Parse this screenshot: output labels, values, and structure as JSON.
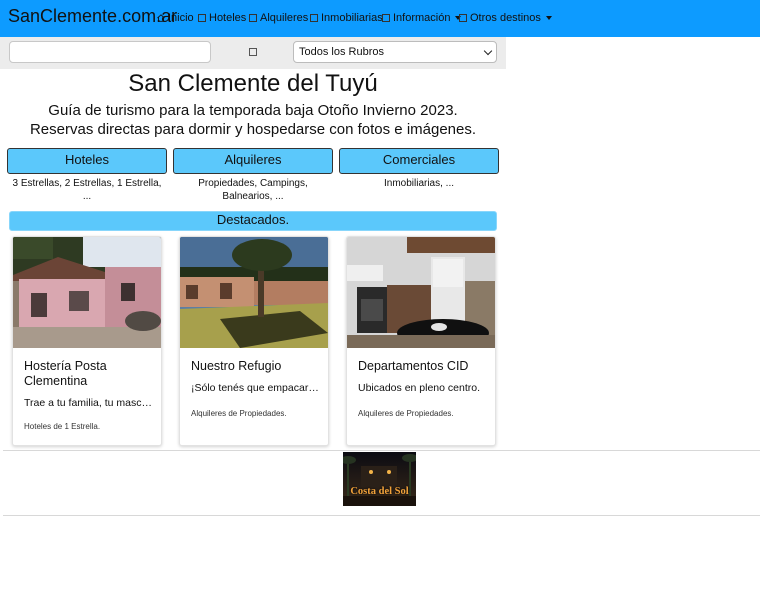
{
  "navbar": {
    "brand": "SanClemente.com.ar",
    "items": [
      {
        "label": "Inicio",
        "icon": "home-icon"
      },
      {
        "label": "Hoteles",
        "icon": "square-icon"
      },
      {
        "label": "Alquileres",
        "icon": "square-icon"
      },
      {
        "label": "Inmobiliarias",
        "icon": "square-icon"
      },
      {
        "label": "Información",
        "icon": "square-icon",
        "dropdown": true
      },
      {
        "label": "Otros destinos",
        "icon": "square-icon",
        "dropdown": true
      }
    ],
    "color": "#0d9bff"
  },
  "search": {
    "placeholder": "",
    "category_selected": "Todos los Rubros"
  },
  "header": {
    "title": "San Clemente del Tuyú",
    "subtitle": "Guía de turismo para la temporada baja Otoño Invierno 2023. Reservas directas para dormir y hospedarse con fotos e imágenes."
  },
  "categories": [
    {
      "label": "Hoteles",
      "description": "3 Estrellas, 2 Estrellas, 1 Estrella, ..."
    },
    {
      "label": "Alquileres",
      "description": "Propiedades, Campings, Balnearios, ..."
    },
    {
      "label": "Comerciales",
      "description": "Inmobiliarias, ..."
    }
  ],
  "featured": {
    "heading": "Destacados.",
    "cards": [
      {
        "title": "Hostería Posta Clementina",
        "text": "Trae a tu familia, tu mascot...",
        "category": "Hoteles de 1 Estrella."
      },
      {
        "title": "Nuestro Refugio",
        "text": "¡Sólo tenés que empacar t...",
        "category": "Alquileres de Propiedades."
      },
      {
        "title": "Departamentos CID",
        "text": "Ubicados en pleno centro.",
        "category": "Alquileres de Propiedades."
      }
    ]
  },
  "banner": {
    "text": "Costa del Sol"
  },
  "colors": {
    "accent": "#5bc8fb",
    "nav": "#0d9bff"
  }
}
